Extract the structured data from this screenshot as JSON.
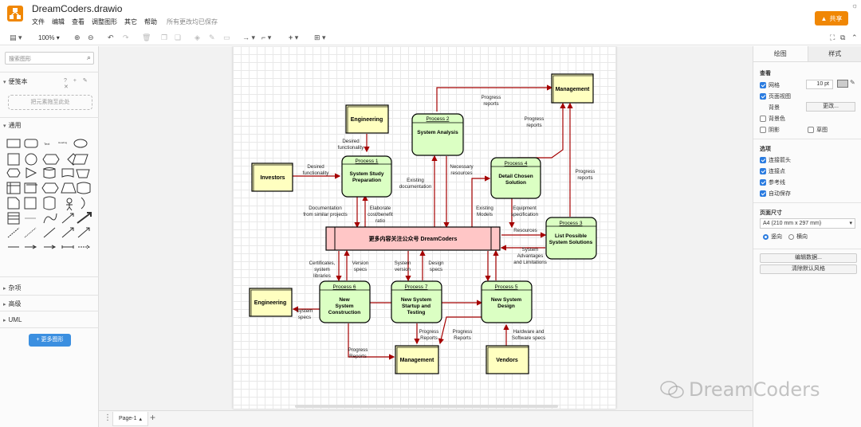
{
  "app": {
    "title": "DreamCoders.drawio",
    "menu": [
      "文件",
      "编辑",
      "查看",
      "调整图形",
      "其它",
      "帮助"
    ],
    "save_status": "所有更改均已保存",
    "share_label": "共享"
  },
  "toolbar": {
    "zoom": "100%"
  },
  "left_panel": {
    "search_placeholder": "搜索图形",
    "scratchpad_title": "便笺本",
    "scratchpad_icons": "? + ✎ ✕",
    "dropzone_text": "把元素拖至此处",
    "general_title": "通用",
    "misc_title": "杂项",
    "advanced_title": "高级",
    "uml_title": "UML",
    "more_shapes": "+ 更多图形"
  },
  "bottom": {
    "page_tab": "Page-1"
  },
  "right_panel": {
    "tab_diagram": "绘图",
    "tab_style": "样式",
    "view_title": "查看",
    "grid_label": "网格",
    "grid_size": "10 pt",
    "page_view_label": "页面视图",
    "background_label": "背景",
    "change_button": "更改...",
    "bg_color_label": "背景色",
    "shadow_label": "阴影",
    "sketch_label": "草图",
    "options_title": "选项",
    "connection_arrows": "连接箭头",
    "connection_points": "连接点",
    "guides": "参考线",
    "autosave": "自动保存",
    "paper_size_title": "页面尺寸",
    "paper_size": "A4 (210 mm x 297 mm)",
    "portrait": "竖向",
    "landscape": "横向",
    "edit_data": "编辑数据...",
    "clear_style": "清除默认风格"
  },
  "watermark": "DreamCoders",
  "diagram": {
    "nodes": {
      "management_top": "Management",
      "engineering_top": "Engineering",
      "investors": "Investors",
      "process1_id": "Process 1",
      "process1_name": "System Study Preparation",
      "process2_id": "Process 2",
      "process2_name": "System Analysis",
      "process4_id": "Process 4",
      "process4_name": "Detail Chosen Solution",
      "process3_id": "Process 3",
      "process3_name": "List Possible System Solutions",
      "datastore": "更多内容关注公众号 DreamCoders",
      "process6_id": "Process 6",
      "process6_name": "New System Construction",
      "process7_id": "Process 7",
      "process7_name": "New System Startup and Testing",
      "process5_id": "Process 5",
      "process5_name": "New System Design",
      "engineering_left": "Engineering",
      "management_bottom": "Management",
      "vendors": "Vendors"
    },
    "labels": {
      "progress_reports_1": "Progress reports",
      "progress_reports_2": "Progress reports",
      "progress_reports_3": "Progress reports",
      "desired_func_1": "Desired functionality",
      "desired_func_2": "Desired functionality",
      "existing_doc": "Existing documentation",
      "necessary_res": "Necessary resources",
      "doc_similar": "Documentation from similar projects",
      "elaborate": "Elaborate cost/benefit ratio",
      "existing_models": "Existing Models",
      "equipment_spec": "Equipment specification",
      "resources": "Resources",
      "sys_adv": "System Advantages and Limitations",
      "certificates": "Certificates, system libraries",
      "version_specs": "Version specs",
      "system_version": "System version",
      "design_specs": "Design specs",
      "system_specs": "System specs",
      "progress_reports_b1": "Progress Reports",
      "progress_reports_b2": "Progress Reports",
      "progress_reports_b3": "Progress Reports",
      "hw_sw": "Hardware and Software specs"
    }
  }
}
